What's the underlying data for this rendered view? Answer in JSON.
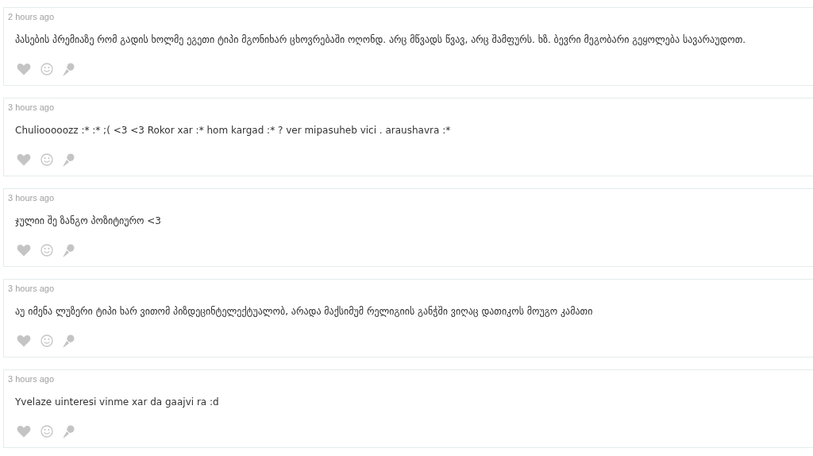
{
  "comments": [
    {
      "time": "2 hours ago",
      "text": "პასების პრემიაზე რომ გადის ხოლმე ეგეთი ტიპი მგონიხარ ცხოვრებაში ოღონდ. არც მწვადს წვავ, არც შამფურს. ხზ. ბევრი მეგობარი გეყოლება სავარაუდოთ."
    },
    {
      "time": "3 hours ago",
      "text": "Chuliooooozz :* :* ;( <3 <3 Rokor xar :* hom kargad :* ? ver mipasuheb vici . araushavra :*"
    },
    {
      "time": "3 hours ago",
      "text": "ჯულიი შე ზანგო პოზიტიურო <3"
    },
    {
      "time": "3 hours ago",
      "text": "აუ იმენა ლუზერი ტიპი ხარ ვითომ პიზდეცინტელექტუალობ, არადა მაქსიმუმ რელიგიის განჭში ვიღაც დათიკოს მოუგო კამათი"
    },
    {
      "time": "3 hours ago",
      "text": "Yvelaze uinteresi vinme xar da gaajvi ra :d"
    }
  ]
}
